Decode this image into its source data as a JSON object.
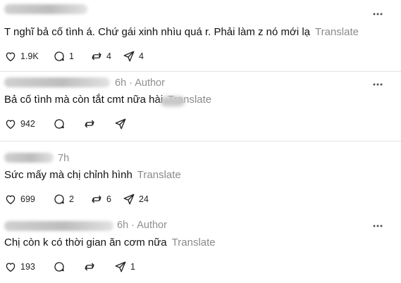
{
  "comments": [
    {
      "time": "",
      "author_tag": "",
      "text": "T nghĩ bả cố tình á. Chứ gái xinh nhìu quá r. Phải làm z nó mới lạ",
      "translate_label": "Translate",
      "likes": "1.9K",
      "replies": "1",
      "reposts": "4",
      "shares": "4"
    },
    {
      "time": "6h",
      "author_tag": "· Author",
      "text": "Bả cố tình mà còn tắt cmt nữa hài",
      "translate_label": "Translate",
      "likes": "942",
      "replies": "",
      "reposts": "",
      "shares": ""
    },
    {
      "time": "7h",
      "author_tag": "",
      "text": "Sức mấy mà chị chỉnh hình",
      "translate_label": "Translate",
      "likes": "699",
      "replies": "2",
      "reposts": "6",
      "shares": "24"
    },
    {
      "time": "6h",
      "author_tag": "· Author",
      "text": "Chị còn k có thời gian ăn cơm nữa",
      "translate_label": "Translate",
      "likes": "193",
      "replies": "",
      "reposts": "",
      "shares": "1"
    }
  ],
  "icons": {
    "like": "heart-icon",
    "reply": "comment-icon",
    "repost": "repost-icon",
    "share": "send-icon",
    "more": "more-icon"
  }
}
